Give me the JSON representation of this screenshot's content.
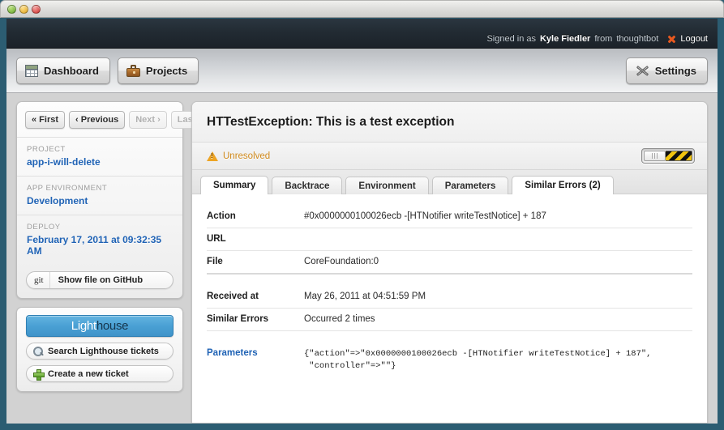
{
  "window": {
    "traffic_lights": [
      "green",
      "yellow",
      "red"
    ]
  },
  "topbar": {
    "signed_in_prefix": "Signed in as",
    "user_name": "Kyle Fiedler",
    "org_prefix": "from",
    "org_name": "thoughtbot",
    "logout_label": "Logout",
    "logout_icon": "close-x-icon"
  },
  "navbar": {
    "items": [
      {
        "label": "Dashboard",
        "icon": "grid-icon"
      },
      {
        "label": "Projects",
        "icon": "briefcase-icon"
      }
    ],
    "settings": {
      "label": "Settings",
      "icon": "tools-icon"
    }
  },
  "sidebar": {
    "pager": [
      {
        "label": "« First",
        "disabled": false
      },
      {
        "label": "‹ Previous",
        "disabled": false
      },
      {
        "label": "Next ›",
        "disabled": true
      },
      {
        "label": "Last »",
        "disabled": true
      }
    ],
    "meta": [
      {
        "label": "PROJECT",
        "value": "app-i-will-delete"
      },
      {
        "label": "APP ENVIRONMENT",
        "value": "Development"
      },
      {
        "label": "DEPLOY",
        "value": "February 17, 2011 at 09:32:35 AM"
      }
    ],
    "git_button": {
      "tag": "git",
      "label": "Show file on GitHub"
    },
    "lighthouse": {
      "logo_part_a": "Light",
      "logo_part_b": "house",
      "buttons": [
        {
          "label": "Search Lighthouse tickets",
          "icon": "magnifier-icon"
        },
        {
          "label": "Create a new ticket",
          "icon": "plus-icon"
        }
      ]
    }
  },
  "main": {
    "error_title": "HTTestException: This is a test exception",
    "status": {
      "label": "Unresolved",
      "icon": "warning-triangle-icon",
      "color": "#d08a1c"
    },
    "toggle": {
      "state": "off",
      "icon": "hazard-stripes-toggle"
    },
    "tabs": [
      {
        "label": "Summary",
        "active": true
      },
      {
        "label": "Backtrace",
        "active": false
      },
      {
        "label": "Environment",
        "active": false
      },
      {
        "label": "Parameters",
        "active": false
      },
      {
        "label": "Similar Errors (2)",
        "active": true
      }
    ],
    "details": [
      {
        "key": "Action",
        "value": "#0x0000000100026ecb -[HTNotifier writeTestNotice] + 187"
      },
      {
        "key": "URL",
        "value": ""
      },
      {
        "key": "File",
        "value": "CoreFoundation:0"
      },
      {
        "key": "Received at",
        "value": "May 26, 2011 at 04:51:59 PM"
      },
      {
        "key": "Similar Errors",
        "value": "Occurred 2 times"
      }
    ],
    "parameters": {
      "key": "Parameters",
      "value": "{\"action\"=>\"0x0000000100026ecb -[HTNotifier writeTestNotice] + 187\",\n \"controller\"=>\"\"}"
    }
  }
}
